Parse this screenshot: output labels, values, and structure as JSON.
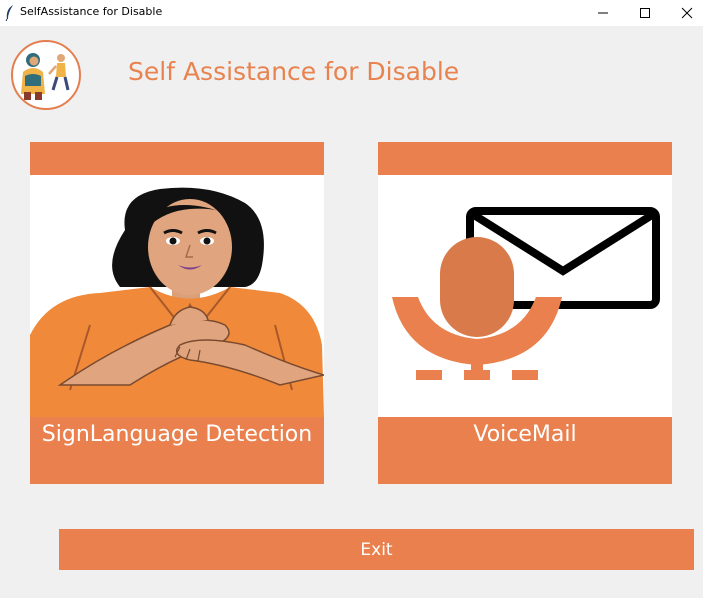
{
  "window": {
    "title": "SelfAssistance for Disable",
    "controls": {
      "minimize": "minimize",
      "maximize": "maximize",
      "close": "close"
    }
  },
  "header": {
    "title": "Self Assistance for Disable",
    "logo_icon": "people-walking-logo-icon"
  },
  "cards": [
    {
      "label": "SignLanguage Detection",
      "icon": "sign-language-woman-illustration"
    },
    {
      "label": "VoiceMail",
      "icon": "microphone-envelope-icon"
    }
  ],
  "footer": {
    "exit_label": "Exit"
  },
  "colors": {
    "accent": "#e9804d",
    "title_text": "#e8834f",
    "background": "#f0f0f0",
    "mic": "#d97a4b"
  }
}
